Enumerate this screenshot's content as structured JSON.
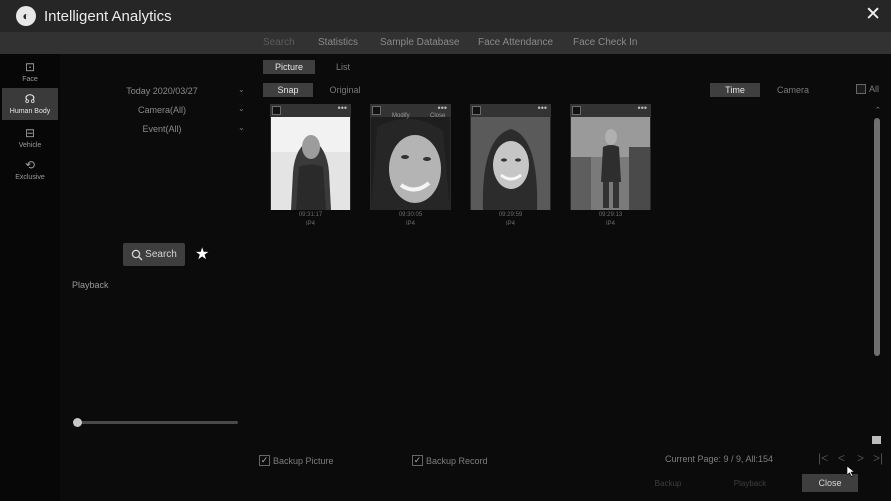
{
  "app": {
    "title": "Intelligent Analytics",
    "close_glyph": "✕",
    "logo_glyph": "◐"
  },
  "tabs": [
    {
      "label": "Search",
      "active": true
    },
    {
      "label": "Statistics",
      "active": false
    },
    {
      "label": "Sample Database",
      "active": false
    },
    {
      "label": "Face Attendance",
      "active": false
    },
    {
      "label": "Face Check In",
      "active": false
    }
  ],
  "sidebar": {
    "items": [
      {
        "label": "Face",
        "icon": "face-scan-icon",
        "glyph": "⊡",
        "active": false
      },
      {
        "label": "Human Body",
        "icon": "human-body-icon",
        "glyph": "☊",
        "active": true
      },
      {
        "label": "Vehicle",
        "icon": "vehicle-icon",
        "glyph": "⊟",
        "active": false
      },
      {
        "label": "Exclusive",
        "icon": "exclusive-icon",
        "glyph": "⟲",
        "active": false
      }
    ]
  },
  "filters": {
    "date": "Today 2020/03/27",
    "camera": "Camera(All)",
    "event": "Event(All)",
    "caret": "⌄"
  },
  "search": {
    "label": "Search",
    "icon": "search-icon",
    "favorite_icon": "star-icon",
    "star_glyph": "★"
  },
  "playback": {
    "label": "Playback",
    "position": 0.0
  },
  "view_toggle": {
    "picture": "Picture",
    "list": "List",
    "selected": "picture"
  },
  "image_toggle": {
    "snap": "Snap",
    "original": "Original",
    "selected": "snap"
  },
  "sort_toggle": {
    "time": "Time",
    "camera": "Camera",
    "selected": "time"
  },
  "select_all": {
    "label": "All",
    "checked": false
  },
  "results": [
    {
      "time": "09:31:17",
      "camera": "IP4",
      "hover_a": "",
      "hover_b": ""
    },
    {
      "time": "09:30:05",
      "camera": "IP4",
      "hover_a": "Modify",
      "hover_b": "Close"
    },
    {
      "time": "09:29:59",
      "camera": "IP4",
      "hover_a": "",
      "hover_b": ""
    },
    {
      "time": "09:29:13",
      "camera": "IP4",
      "hover_a": "",
      "hover_b": ""
    }
  ],
  "card_more": "•••",
  "backup": {
    "picture": "Backup Picture",
    "record": "Backup Record",
    "check_glyph": "✓"
  },
  "pagination": {
    "info": "Current Page: 9 / 9, All:154",
    "first": "|<",
    "prev": "<",
    "next": ">",
    "last": ">|"
  },
  "footer": {
    "btn_a": "Backup",
    "btn_b": "Playback",
    "close": "Close"
  },
  "scroll": {
    "up": "⌃"
  }
}
